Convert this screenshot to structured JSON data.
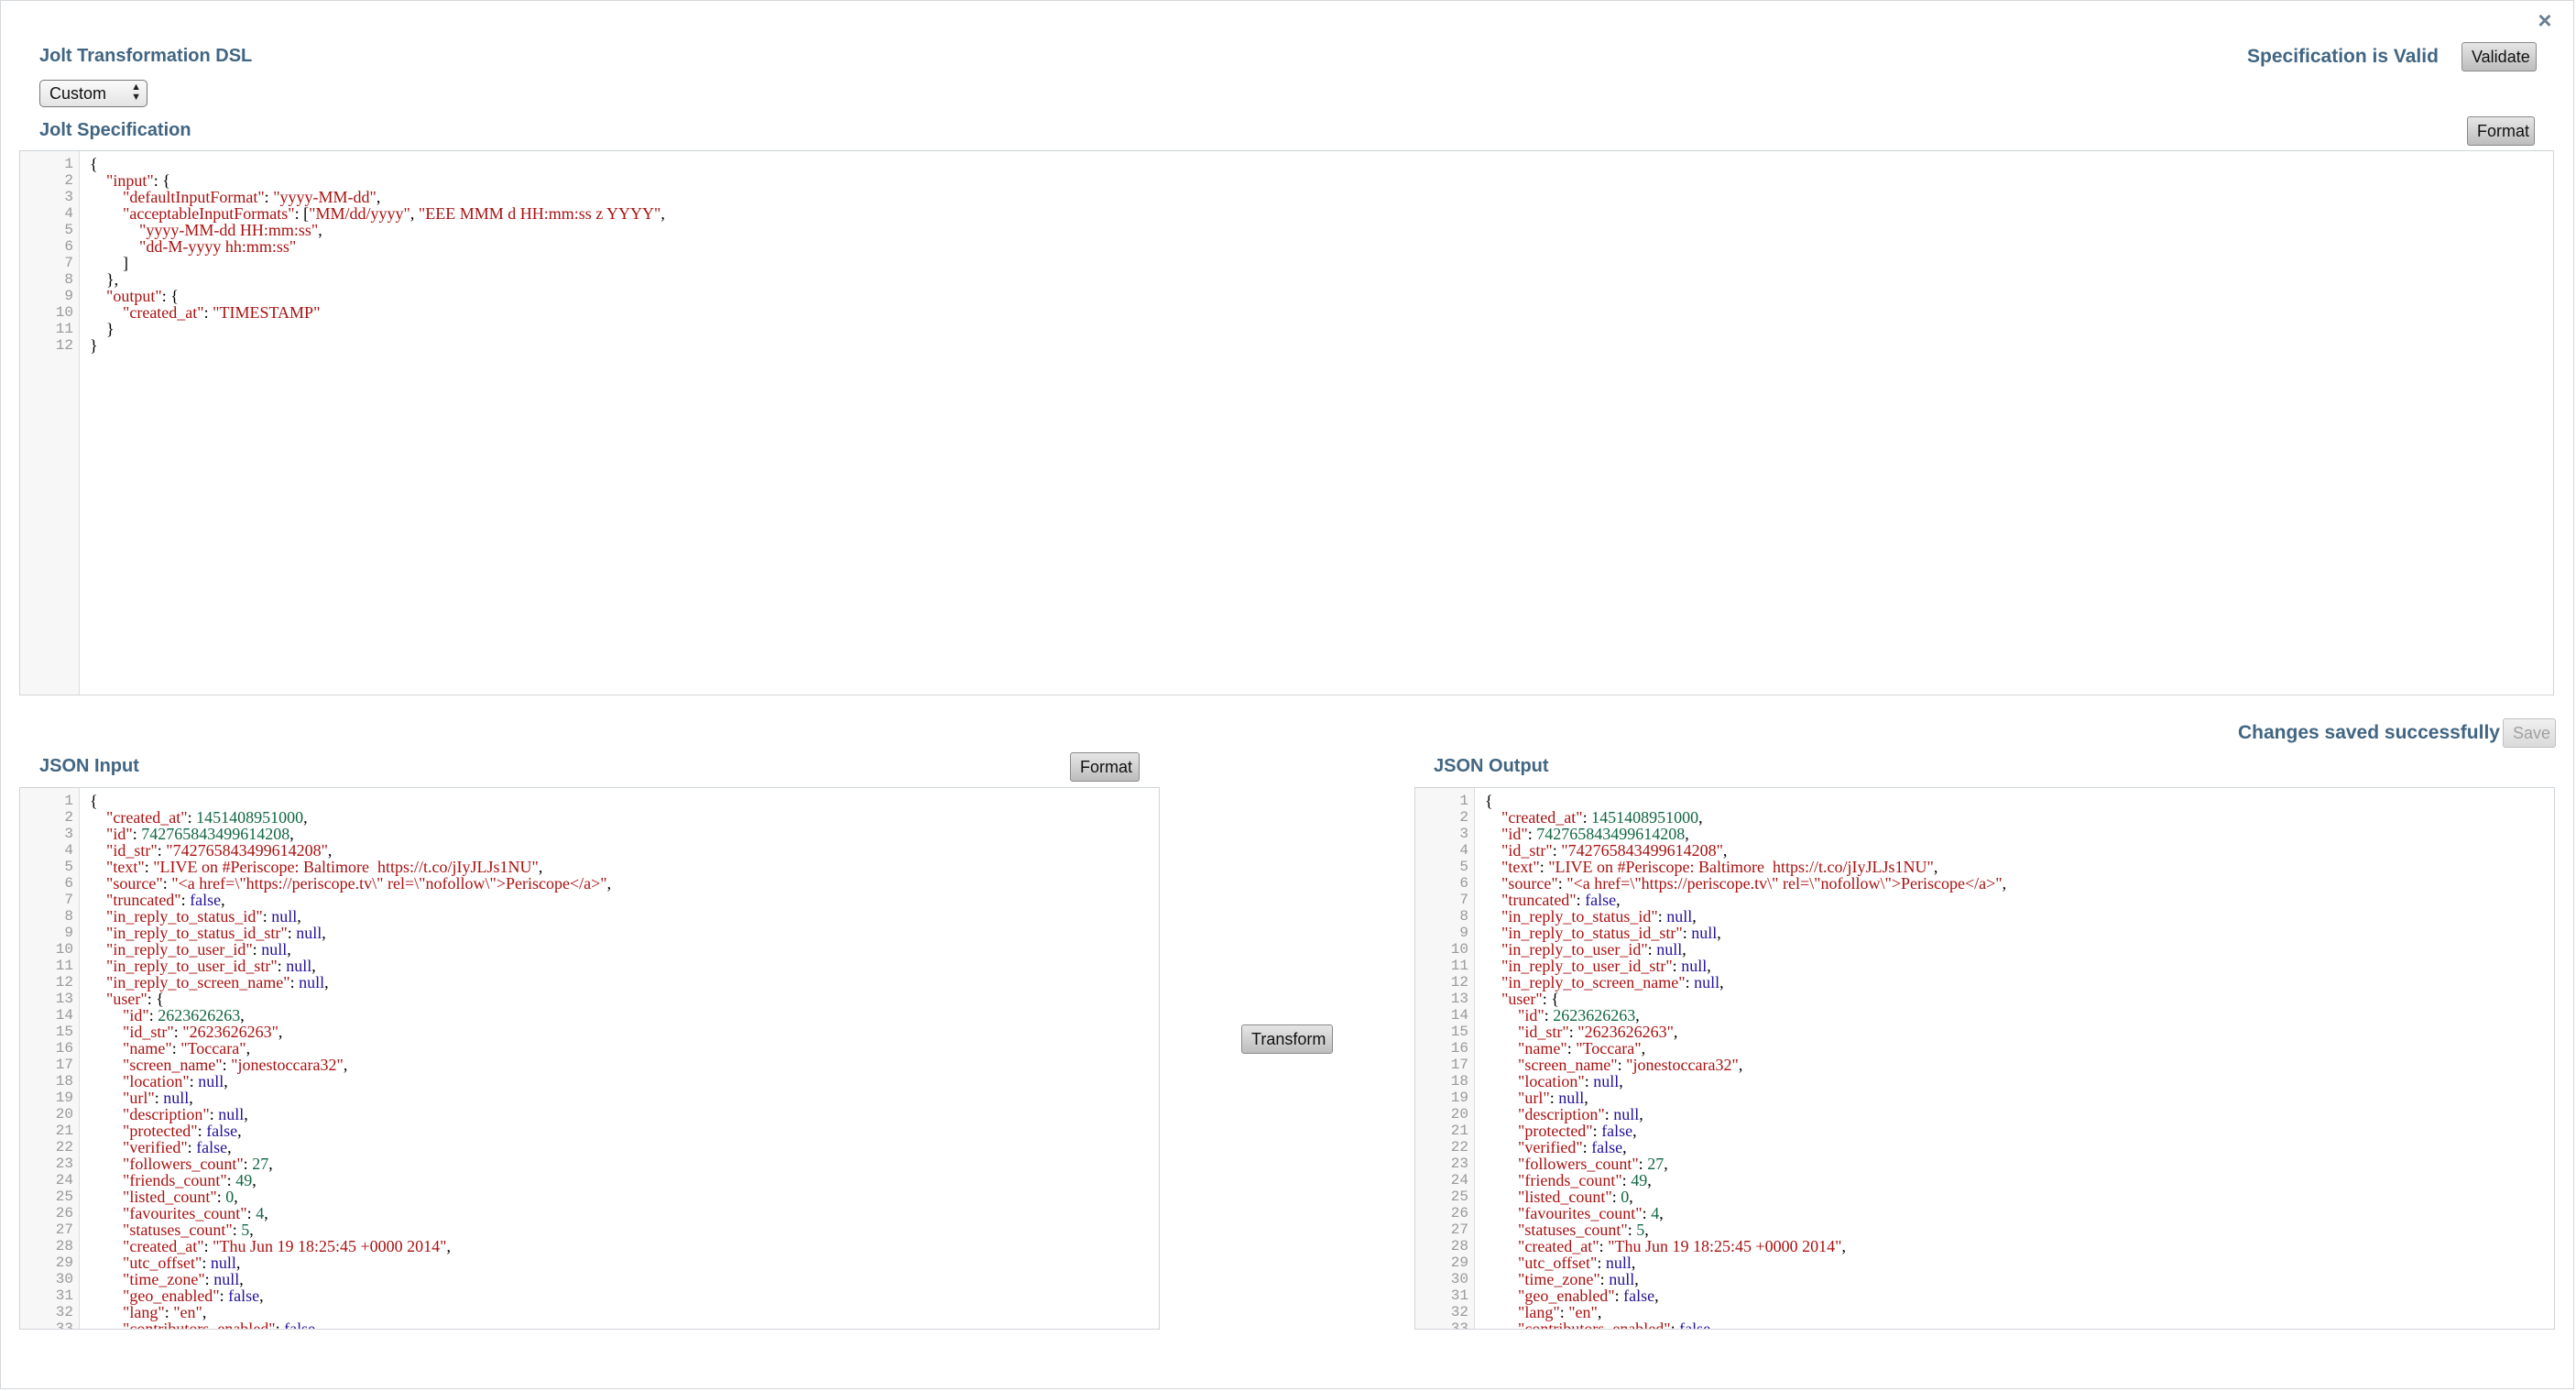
{
  "header": {
    "title": "Jolt Transformation DSL",
    "spec_status": "Specification is Valid",
    "validate_label": "Validate",
    "close_glyph": "×"
  },
  "dsl_select": {
    "value": "Custom"
  },
  "spec": {
    "title": "Jolt Specification",
    "format_label": "Format",
    "lines": [
      [
        [
          "p",
          "{"
        ]
      ],
      [
        [
          "p",
          "    "
        ],
        [
          "k",
          "\"input\""
        ],
        [
          "p",
          ": {"
        ]
      ],
      [
        [
          "p",
          "        "
        ],
        [
          "k",
          "\"defaultInputFormat\""
        ],
        [
          "p",
          ": "
        ],
        [
          "s",
          "\"yyyy-MM-dd\""
        ],
        [
          "p",
          ","
        ]
      ],
      [
        [
          "p",
          "        "
        ],
        [
          "k",
          "\"acceptableInputFormats\""
        ],
        [
          "p",
          ": ["
        ],
        [
          "s",
          "\"MM/dd/yyyy\""
        ],
        [
          "p",
          ", "
        ],
        [
          "s",
          "\"EEE MMM d HH:mm:ss z YYYY\""
        ],
        [
          "p",
          ","
        ]
      ],
      [
        [
          "p",
          "            "
        ],
        [
          "s",
          "\"yyyy-MM-dd HH:mm:ss\""
        ],
        [
          "p",
          ","
        ]
      ],
      [
        [
          "p",
          "            "
        ],
        [
          "s",
          "\"dd-M-yyyy hh:mm:ss\""
        ]
      ],
      [
        [
          "p",
          "        ]"
        ]
      ],
      [
        [
          "p",
          "    },"
        ]
      ],
      [
        [
          "p",
          "    "
        ],
        [
          "k",
          "\"output\""
        ],
        [
          "p",
          ": {"
        ]
      ],
      [
        [
          "p",
          "        "
        ],
        [
          "k",
          "\"created_at\""
        ],
        [
          "p",
          ": "
        ],
        [
          "s",
          "\"TIMESTAMP\""
        ]
      ],
      [
        [
          "p",
          "    }"
        ]
      ],
      [
        [
          "p",
          "}"
        ]
      ]
    ]
  },
  "save": {
    "status": "Changes saved successfully",
    "label": "Save"
  },
  "input": {
    "title": "JSON Input",
    "format_label": "Format"
  },
  "transform_label": "Transform",
  "output": {
    "title": "JSON Output"
  },
  "json_lines": [
    [
      [
        "p",
        "{"
      ]
    ],
    [
      [
        "p",
        "    "
      ],
      [
        "k",
        "\"created_at\""
      ],
      [
        "p",
        ": "
      ],
      [
        "n",
        "1451408951000"
      ],
      [
        "p",
        ","
      ]
    ],
    [
      [
        "p",
        "    "
      ],
      [
        "k",
        "\"id\""
      ],
      [
        "p",
        ": "
      ],
      [
        "n",
        "742765843499614208"
      ],
      [
        "p",
        ","
      ]
    ],
    [
      [
        "p",
        "    "
      ],
      [
        "k",
        "\"id_str\""
      ],
      [
        "p",
        ": "
      ],
      [
        "s",
        "\"742765843499614208\""
      ],
      [
        "p",
        ","
      ]
    ],
    [
      [
        "p",
        "    "
      ],
      [
        "k",
        "\"text\""
      ],
      [
        "p",
        ": "
      ],
      [
        "s",
        "\"LIVE on #Periscope: Baltimore  https://t.co/jIyJLJs1NU\""
      ],
      [
        "p",
        ","
      ]
    ],
    [
      [
        "p",
        "    "
      ],
      [
        "k",
        "\"source\""
      ],
      [
        "p",
        ": "
      ],
      [
        "s",
        "\"<a href=\\\"https://periscope.tv\\\" rel=\\\"nofollow\\\">Periscope</a>\""
      ],
      [
        "p",
        ","
      ]
    ],
    [
      [
        "p",
        "    "
      ],
      [
        "k",
        "\"truncated\""
      ],
      [
        "p",
        ": "
      ],
      [
        "a",
        "false"
      ],
      [
        "p",
        ","
      ]
    ],
    [
      [
        "p",
        "    "
      ],
      [
        "k",
        "\"in_reply_to_status_id\""
      ],
      [
        "p",
        ": "
      ],
      [
        "a",
        "null"
      ],
      [
        "p",
        ","
      ]
    ],
    [
      [
        "p",
        "    "
      ],
      [
        "k",
        "\"in_reply_to_status_id_str\""
      ],
      [
        "p",
        ": "
      ],
      [
        "a",
        "null"
      ],
      [
        "p",
        ","
      ]
    ],
    [
      [
        "p",
        "    "
      ],
      [
        "k",
        "\"in_reply_to_user_id\""
      ],
      [
        "p",
        ": "
      ],
      [
        "a",
        "null"
      ],
      [
        "p",
        ","
      ]
    ],
    [
      [
        "p",
        "    "
      ],
      [
        "k",
        "\"in_reply_to_user_id_str\""
      ],
      [
        "p",
        ": "
      ],
      [
        "a",
        "null"
      ],
      [
        "p",
        ","
      ]
    ],
    [
      [
        "p",
        "    "
      ],
      [
        "k",
        "\"in_reply_to_screen_name\""
      ],
      [
        "p",
        ": "
      ],
      [
        "a",
        "null"
      ],
      [
        "p",
        ","
      ]
    ],
    [
      [
        "p",
        "    "
      ],
      [
        "k",
        "\"user\""
      ],
      [
        "p",
        ": {"
      ]
    ],
    [
      [
        "p",
        "        "
      ],
      [
        "k",
        "\"id\""
      ],
      [
        "p",
        ": "
      ],
      [
        "n",
        "2623626263"
      ],
      [
        "p",
        ","
      ]
    ],
    [
      [
        "p",
        "        "
      ],
      [
        "k",
        "\"id_str\""
      ],
      [
        "p",
        ": "
      ],
      [
        "s",
        "\"2623626263\""
      ],
      [
        "p",
        ","
      ]
    ],
    [
      [
        "p",
        "        "
      ],
      [
        "k",
        "\"name\""
      ],
      [
        "p",
        ": "
      ],
      [
        "s",
        "\"Toccara\""
      ],
      [
        "p",
        ","
      ]
    ],
    [
      [
        "p",
        "        "
      ],
      [
        "k",
        "\"screen_name\""
      ],
      [
        "p",
        ": "
      ],
      [
        "s",
        "\"jonestoccara32\""
      ],
      [
        "p",
        ","
      ]
    ],
    [
      [
        "p",
        "        "
      ],
      [
        "k",
        "\"location\""
      ],
      [
        "p",
        ": "
      ],
      [
        "a",
        "null"
      ],
      [
        "p",
        ","
      ]
    ],
    [
      [
        "p",
        "        "
      ],
      [
        "k",
        "\"url\""
      ],
      [
        "p",
        ": "
      ],
      [
        "a",
        "null"
      ],
      [
        "p",
        ","
      ]
    ],
    [
      [
        "p",
        "        "
      ],
      [
        "k",
        "\"description\""
      ],
      [
        "p",
        ": "
      ],
      [
        "a",
        "null"
      ],
      [
        "p",
        ","
      ]
    ],
    [
      [
        "p",
        "        "
      ],
      [
        "k",
        "\"protected\""
      ],
      [
        "p",
        ": "
      ],
      [
        "a",
        "false"
      ],
      [
        "p",
        ","
      ]
    ],
    [
      [
        "p",
        "        "
      ],
      [
        "k",
        "\"verified\""
      ],
      [
        "p",
        ": "
      ],
      [
        "a",
        "false"
      ],
      [
        "p",
        ","
      ]
    ],
    [
      [
        "p",
        "        "
      ],
      [
        "k",
        "\"followers_count\""
      ],
      [
        "p",
        ": "
      ],
      [
        "n",
        "27"
      ],
      [
        "p",
        ","
      ]
    ],
    [
      [
        "p",
        "        "
      ],
      [
        "k",
        "\"friends_count\""
      ],
      [
        "p",
        ": "
      ],
      [
        "n",
        "49"
      ],
      [
        "p",
        ","
      ]
    ],
    [
      [
        "p",
        "        "
      ],
      [
        "k",
        "\"listed_count\""
      ],
      [
        "p",
        ": "
      ],
      [
        "n",
        "0"
      ],
      [
        "p",
        ","
      ]
    ],
    [
      [
        "p",
        "        "
      ],
      [
        "k",
        "\"favourites_count\""
      ],
      [
        "p",
        ": "
      ],
      [
        "n",
        "4"
      ],
      [
        "p",
        ","
      ]
    ],
    [
      [
        "p",
        "        "
      ],
      [
        "k",
        "\"statuses_count\""
      ],
      [
        "p",
        ": "
      ],
      [
        "n",
        "5"
      ],
      [
        "p",
        ","
      ]
    ],
    [
      [
        "p",
        "        "
      ],
      [
        "k",
        "\"created_at\""
      ],
      [
        "p",
        ": "
      ],
      [
        "s",
        "\"Thu Jun 19 18:25:45 +0000 2014\""
      ],
      [
        "p",
        ","
      ]
    ],
    [
      [
        "p",
        "        "
      ],
      [
        "k",
        "\"utc_offset\""
      ],
      [
        "p",
        ": "
      ],
      [
        "a",
        "null"
      ],
      [
        "p",
        ","
      ]
    ],
    [
      [
        "p",
        "        "
      ],
      [
        "k",
        "\"time_zone\""
      ],
      [
        "p",
        ": "
      ],
      [
        "a",
        "null"
      ],
      [
        "p",
        ","
      ]
    ],
    [
      [
        "p",
        "        "
      ],
      [
        "k",
        "\"geo_enabled\""
      ],
      [
        "p",
        ": "
      ],
      [
        "a",
        "false"
      ],
      [
        "p",
        ","
      ]
    ],
    [
      [
        "p",
        "        "
      ],
      [
        "k",
        "\"lang\""
      ],
      [
        "p",
        ": "
      ],
      [
        "s",
        "\"en\""
      ],
      [
        "p",
        ","
      ]
    ],
    [
      [
        "p",
        "        "
      ],
      [
        "k",
        "\"contributors_enabled\""
      ],
      [
        "p",
        ": "
      ],
      [
        "a",
        "false"
      ]
    ]
  ],
  "colors": {
    "heading": "#416582",
    "string": "#aa1111",
    "number": "#116644",
    "atom": "#221199"
  }
}
